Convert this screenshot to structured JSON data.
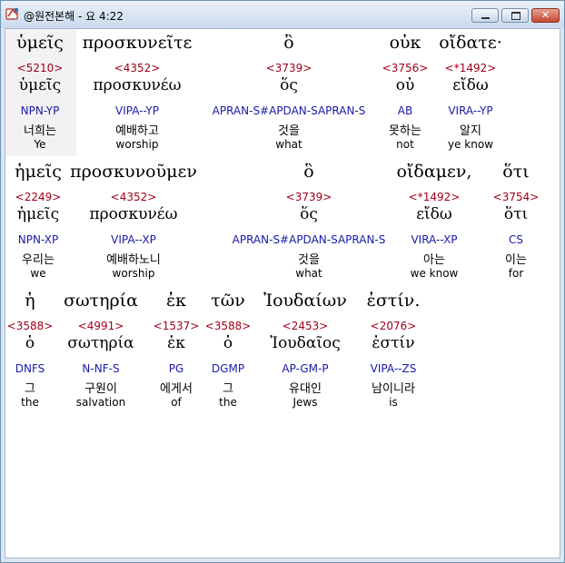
{
  "window": {
    "title": "@원전본해 - 요 4:22",
    "app_icon": "bible-app-icon"
  },
  "title_buttons": {
    "minimize": "minimize",
    "maximize": "maximize",
    "close": "close"
  },
  "verse_rows": [
    {
      "cells": [
        {
          "greek": "ὑμεῖς",
          "strong": "<5210>",
          "lemma": "ὑμεῖς",
          "morph": "NPN-YP",
          "korean": "너희는",
          "english": "Ye"
        },
        {
          "greek": "προσκυνεῖτε",
          "strong": "<4352>",
          "lemma": "προσκυνέω",
          "morph": "VIPA--YP",
          "korean": "예배하고",
          "english": "worship"
        },
        {
          "greek": "ὃ",
          "strong": "<3739>",
          "lemma": "ὅς",
          "morph": "APRAN-S#APDAN-SAPRAN-S",
          "korean": "것을",
          "english": "what"
        },
        {
          "greek": "οὐκ",
          "strong": "<3756>",
          "lemma": "οὐ",
          "morph": "AB",
          "korean": "못하는",
          "english": "not"
        },
        {
          "greek": "οἴδατε·",
          "strong": "<*1492>",
          "lemma": "εἴδω",
          "morph": "VIRA--YP",
          "korean": "알지",
          "english": "ye know"
        }
      ]
    },
    {
      "cells": [
        {
          "greek": "ἡμεῖς",
          "strong": "<2249>",
          "lemma": "ἡμεῖς",
          "morph": "NPN-XP",
          "korean": "우리는",
          "english": "we"
        },
        {
          "greek": "προσκυνοῦμεν",
          "strong": "<4352>",
          "lemma": "προσκυνέω",
          "morph": "VIPA--XP",
          "korean": "예배하노니",
          "english": "worship"
        },
        {
          "greek": "ὃ",
          "strong": "<3739>",
          "lemma": "ὅς",
          "morph": "APRAN-S#APDAN-SAPRAN-S",
          "korean": "것을",
          "english": "what"
        },
        {
          "greek": "οἴδαμεν,",
          "strong": "<*1492>",
          "lemma": "εἴδω",
          "morph": "VIRA--XP",
          "korean": "아는",
          "english": "we know"
        },
        {
          "greek": "ὅτι",
          "strong": "<3754>",
          "lemma": "ὅτι",
          "morph": "CS",
          "korean": "이는",
          "english": "for"
        }
      ]
    },
    {
      "cells": [
        {
          "greek": "ἡ",
          "strong": "<3588>",
          "lemma": "ὁ",
          "morph": "DNFS",
          "korean": "그",
          "english": "the"
        },
        {
          "greek": "σωτηρία",
          "strong": "<4991>",
          "lemma": "σωτηρία",
          "morph": "N-NF-S",
          "korean": "구원이",
          "english": "salvation"
        },
        {
          "greek": "ἐκ",
          "strong": "<1537>",
          "lemma": "ἐκ",
          "morph": "PG",
          "korean": "에게서",
          "english": "of"
        },
        {
          "greek": "τῶν",
          "strong": "<3588>",
          "lemma": "ὁ",
          "morph": "DGMP",
          "korean": "그",
          "english": "the"
        },
        {
          "greek": "Ἰουδαίων",
          "strong": "<2453>",
          "lemma": "Ἰουδαῖος",
          "morph": "AP-GM-P",
          "korean": "유대인",
          "english": "Jews"
        },
        {
          "greek": "ἐστίν.",
          "strong": "<2076>",
          "lemma": "ἐστίν",
          "morph": "VIPA--ZS",
          "korean": "남이니라",
          "english": "is"
        }
      ]
    }
  ],
  "colors": {
    "strong": "#a0001a",
    "morph": "#1a1aa8",
    "selected_cell": "#f2f2f2"
  }
}
